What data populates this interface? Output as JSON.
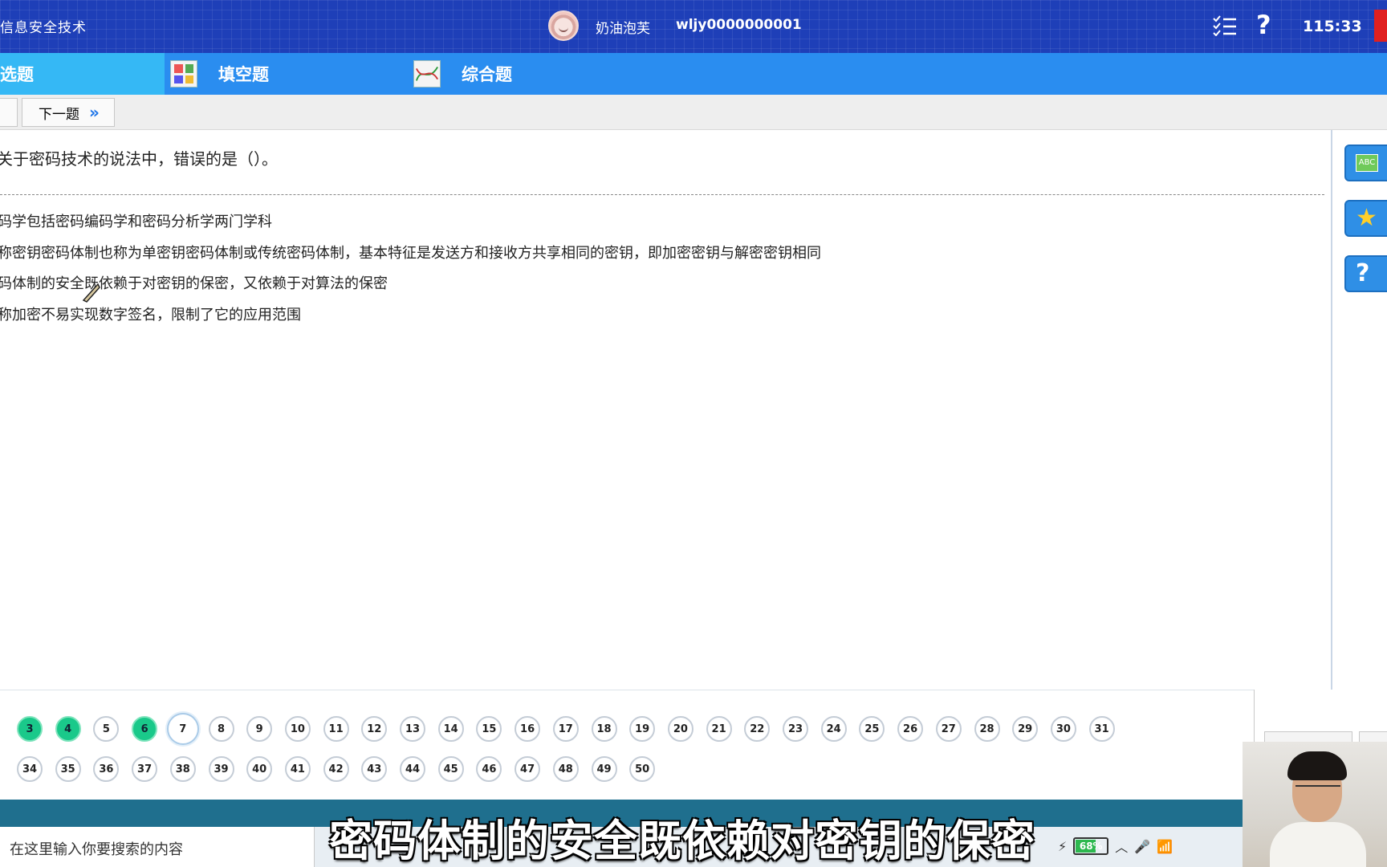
{
  "header": {
    "app_title": "信息安全技术",
    "username": "奶油泡芙",
    "user_id": "wljy0000000001",
    "timer": "115:33",
    "icons": [
      "list-check-icon",
      "help-icon"
    ]
  },
  "tabs": [
    {
      "label": "选题",
      "active": true
    },
    {
      "label": "填空题",
      "icon": "grid-icon"
    },
    {
      "label": "综合题",
      "icon": "chart-icon"
    }
  ],
  "toolbar": {
    "next_label": "下一题",
    "next_icon": "double-chevron-right-icon"
  },
  "question": {
    "text": "关于密码技术的说法中，错误的是（）。",
    "options": [
      "码学包括密码编码学和密码分析学两门学科",
      "称密钥密码体制也称为单密钥密码体制或传统密码体制，基本特征是发送方和接收方共享相同的密钥，即加密密钥与解密密钥相同",
      "码体制的安全既依赖于对密钥的保密，又依赖于对算法的保密",
      "称加密不易实现数字签名，限制了它的应用范围"
    ]
  },
  "side_tools": [
    "abc-note-icon",
    "star-icon",
    "question-icon"
  ],
  "navigator": {
    "rows": [
      [
        {
          "n": "3",
          "state": "done"
        },
        {
          "n": "4",
          "state": "done"
        },
        {
          "n": "5"
        },
        {
          "n": "6",
          "state": "done"
        },
        {
          "n": "7",
          "state": "current"
        },
        {
          "n": "8"
        },
        {
          "n": "9"
        },
        {
          "n": "10"
        },
        {
          "n": "11"
        },
        {
          "n": "12"
        },
        {
          "n": "13"
        },
        {
          "n": "14"
        },
        {
          "n": "15"
        },
        {
          "n": "16"
        },
        {
          "n": "17"
        },
        {
          "n": "18"
        },
        {
          "n": "19"
        },
        {
          "n": "20"
        },
        {
          "n": "21"
        },
        {
          "n": "22"
        },
        {
          "n": "23"
        },
        {
          "n": "24"
        },
        {
          "n": "25"
        },
        {
          "n": "26"
        },
        {
          "n": "27"
        },
        {
          "n": "28"
        },
        {
          "n": "29"
        },
        {
          "n": "30"
        },
        {
          "n": "31"
        }
      ],
      [
        {
          "n": "34"
        },
        {
          "n": "35"
        },
        {
          "n": "36"
        },
        {
          "n": "37"
        },
        {
          "n": "38"
        },
        {
          "n": "39"
        },
        {
          "n": "40"
        },
        {
          "n": "41"
        },
        {
          "n": "42"
        },
        {
          "n": "43"
        },
        {
          "n": "44"
        },
        {
          "n": "45"
        },
        {
          "n": "46"
        },
        {
          "n": "47"
        },
        {
          "n": "48"
        },
        {
          "n": "49"
        },
        {
          "n": "50"
        }
      ]
    ]
  },
  "taskbar": {
    "search_placeholder": "在这里输入你要搜索的内容",
    "battery": "68%"
  },
  "subtitle": "密码体制的安全既依赖对密钥的保密",
  "colors": {
    "header_bg": "#1e3fb8",
    "tab_bg": "#2a8df0",
    "tab_active": "#35b8f5",
    "answered": "#1ac98a"
  }
}
